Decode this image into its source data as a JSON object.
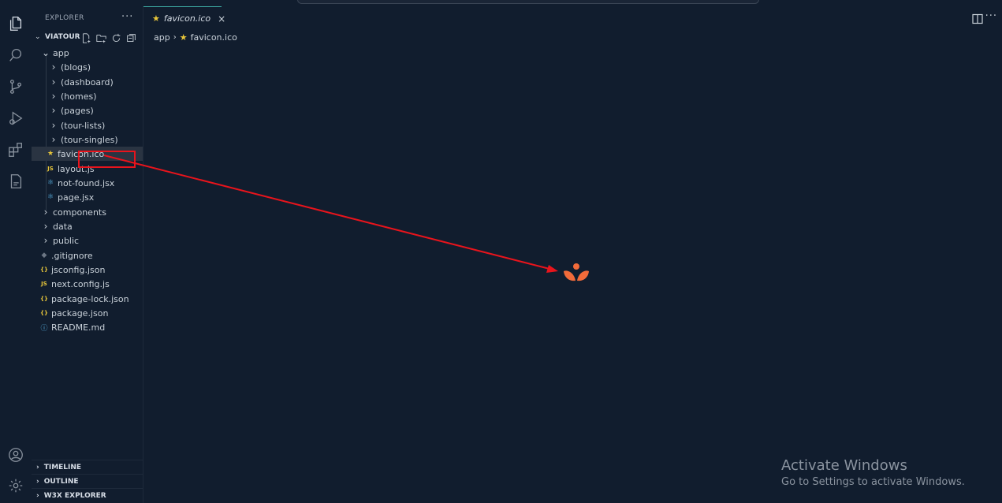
{
  "explorer": {
    "title": "EXPLORER",
    "more": "···",
    "project": "VIATOUR",
    "tree": [
      {
        "label": "app",
        "icon": "chevron-down-icon",
        "glyph": "⌄"
      },
      {
        "label": "(blogs)",
        "icon": "chevron-right-icon",
        "glyph": "›"
      },
      {
        "label": "(dashboard)",
        "icon": "chevron-right-icon",
        "glyph": "›"
      },
      {
        "label": "(homes)",
        "icon": "chevron-right-icon",
        "glyph": "›"
      },
      {
        "label": "(pages)",
        "icon": "chevron-right-icon",
        "glyph": "›"
      },
      {
        "label": "(tour-lists)",
        "icon": "chevron-right-icon",
        "glyph": "›"
      },
      {
        "label": "(tour-singles)",
        "icon": "chevron-right-icon",
        "glyph": "›"
      },
      {
        "label": "favicon.ico",
        "icon": "star-file-icon",
        "glyph": "★"
      },
      {
        "label": "layout.js",
        "icon": "js-file-icon",
        "glyph": "JS"
      },
      {
        "label": "not-found.jsx",
        "icon": "react-file-icon",
        "glyph": "⚛"
      },
      {
        "label": "page.jsx",
        "icon": "react-file-icon",
        "glyph": "⚛"
      },
      {
        "label": "components",
        "icon": "chevron-right-icon",
        "glyph": "›"
      },
      {
        "label": "data",
        "icon": "chevron-right-icon",
        "glyph": "›"
      },
      {
        "label": "public",
        "icon": "chevron-right-icon",
        "glyph": "›"
      },
      {
        "label": ".gitignore",
        "icon": "gitignore-file-icon",
        "glyph": "◆"
      },
      {
        "label": "jsconfig.json",
        "icon": "json-file-icon",
        "glyph": "{}"
      },
      {
        "label": "next.config.js",
        "icon": "js-file-icon",
        "glyph": "JS"
      },
      {
        "label": "package-lock.json",
        "icon": "json-file-icon",
        "glyph": "{}"
      },
      {
        "label": "package.json",
        "icon": "json-file-icon",
        "glyph": "{}"
      },
      {
        "label": "README.md",
        "icon": "info-file-icon",
        "glyph": "ⓘ"
      }
    ],
    "panels": [
      "TIMELINE",
      "OUTLINE",
      "W3X EXPLORER"
    ]
  },
  "editor": {
    "tab_label": "favicon.ico",
    "tab_close": "×",
    "breadcrumb": [
      "app",
      "favicon.ico"
    ],
    "more": "···"
  },
  "watermark": {
    "line1": "Activate Windows",
    "line2": "Go to Settings to activate Windows."
  },
  "colors": {
    "background": "#111d2e",
    "accent": "#3fb1a8",
    "annotation": "#e8141c",
    "favicon": "#f26b3a",
    "star": "#e8c63a",
    "js": "#e8c63a",
    "react": "#5ab5e6"
  }
}
